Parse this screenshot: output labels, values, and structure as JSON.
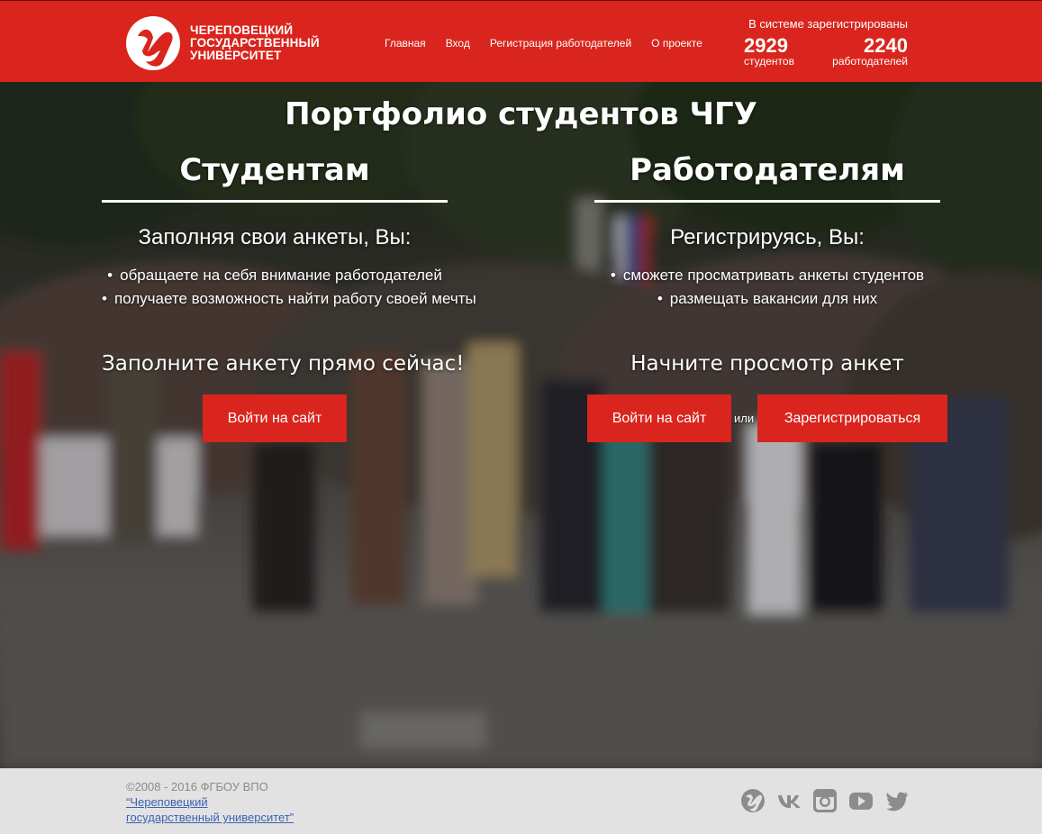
{
  "header": {
    "logo_lines": [
      "ЧЕРЕПОВЕЦКИЙ",
      "ГОСУДАРСТВЕННЫЙ",
      "УНИВЕРСИТЕТ"
    ],
    "nav": [
      "Главная",
      "Вход",
      "Регистрация работодателей",
      "О проекте"
    ],
    "stats": {
      "title": "В системе зарегистрированы",
      "students_count": "2929",
      "students_label": "студентов",
      "employers_count": "2240",
      "employers_label": "работодателей"
    }
  },
  "hero": {
    "title": "Портфолио студентов ЧГУ",
    "students": {
      "heading": "Студентам",
      "subtitle": "Заполняя свои анкеты, Вы:",
      "bullets": [
        "обращаете на себя внимание работодателей",
        "получаете возможность найти работу своей мечты"
      ],
      "cta": "Заполните анкету прямо сейчас!",
      "login_button": "Войти на сайт"
    },
    "employers": {
      "heading": "Работодателям",
      "subtitle": "Регистрируясь, Вы:",
      "bullets": [
        "сможете просматривать анкеты студентов",
        "размещать вакансии для них"
      ],
      "cta": "Начните просмотр анкет",
      "login_button": "Войти на сайт",
      "or": "или",
      "register_button": "Зарегистрироваться"
    }
  },
  "footer": {
    "copyright": "©2008 - 2016 ФГБОУ ВПО",
    "link_line1": "“Череповецкий",
    "link_line2": "государственный университет”",
    "social_icons": [
      "chsu-icon",
      "vk-icon",
      "instagram-icon",
      "youtube-icon",
      "twitter-icon"
    ]
  },
  "colors": {
    "brand_red": "#d9251d",
    "footer_bg": "#e2e2e2",
    "link": "#3a63b0",
    "icon_grey": "#8c8c8c"
  }
}
